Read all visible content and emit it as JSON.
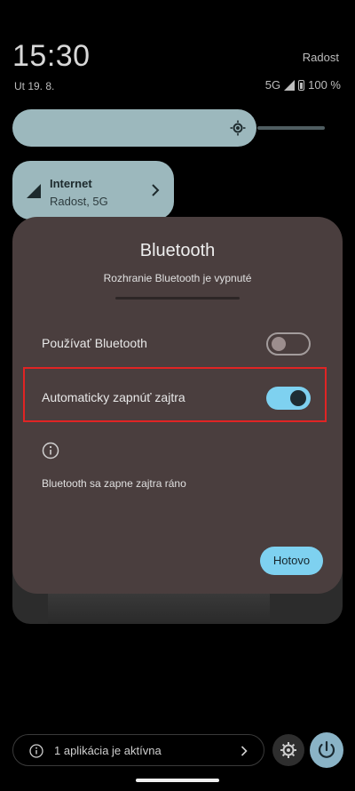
{
  "status": {
    "time": "15:30",
    "carrier": "Radost",
    "date": "Ut 19. 8.",
    "network": "5G",
    "battery": "100 %"
  },
  "brightness": {
    "level": 0.78
  },
  "internet_tile": {
    "title": "Internet",
    "subtitle": "Radost, 5G"
  },
  "dialog": {
    "title": "Bluetooth",
    "subtitle": "Rozhranie Bluetooth je vypnuté",
    "rows": [
      {
        "label": "Používať Bluetooth",
        "enabled": false
      },
      {
        "label": "Automaticky zapnúť zajtra",
        "enabled": true
      }
    ],
    "info_text": "Bluetooth sa zapne zajtra ráno",
    "done_label": "Hotovo"
  },
  "footer": {
    "active_apps_text": "1 aplikácia je aktívna"
  },
  "colors": {
    "accent": "#7ed1f0",
    "dialog_bg": "#4a3e3e",
    "tile_bg": "#9cb8bd",
    "highlight": "#e02424"
  }
}
